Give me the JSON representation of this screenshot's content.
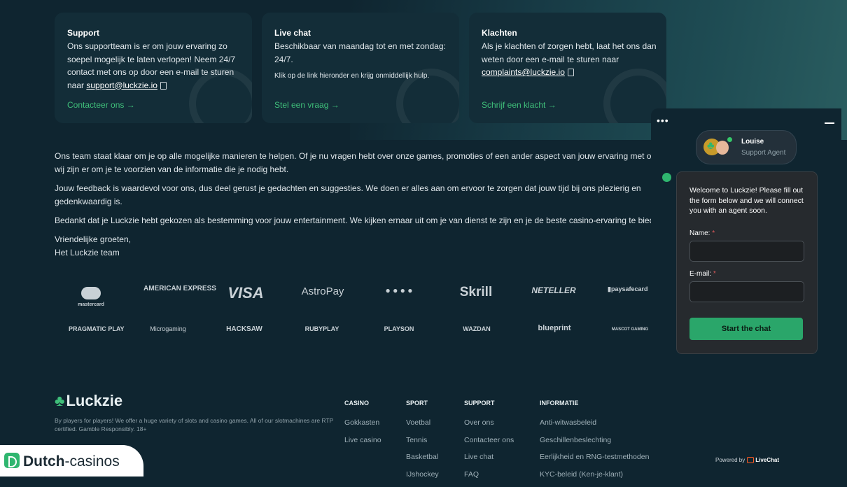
{
  "cards": [
    {
      "title": "Support",
      "body": "Ons supportteam is er om jouw ervaring zo soepel mogelijk te laten verlopen! Neem 24/7 contact met ons op door een e-mail te sturen naar ",
      "email": "support@luckzie.io",
      "link": "Contacteer ons →"
    },
    {
      "title": "Live chat",
      "body": "Beschikbaar van maandag tot en met zondag: 24/7.",
      "small": "Klik op de link hieronder en krijg onmiddellijk hulp.",
      "link": "Stel een vraag →"
    },
    {
      "title": "Klachten",
      "body": "Als je klachten of zorgen hebt, laat het ons dan weten door een e-mail te sturen naar ",
      "email": "complaints@luckzie.io",
      "link": "Schrijf een klacht →"
    }
  ],
  "paragraphs": [
    "Ons team staat klaar om je op alle mogelijke manieren te helpen. Of je nu vragen hebt over onze games, promoties of een ander aspect van jouw ervaring met o wij zijn er om je te voorzien van de informatie die je nodig hebt.",
    "Jouw feedback is waardevol voor ons, dus deel gerust je gedachten en suggesties. We doen er alles aan om ervoor te zorgen dat jouw tijd bij ons plezierig en gedenkwaardig is.",
    "Bedankt dat je Luckzie hebt gekozen als bestemming voor jouw entertainment. We kijken ernaar uit om je van dienst te zijn en je de beste casino-ervaring te bied",
    "Vriendelijke groeten,",
    "Het Luckzie team"
  ],
  "payment_logos": [
    "mastercard",
    "AMERICAN EXPRESS",
    "VISA",
    "AstroPay",
    "● ● ● ●",
    "Skrill",
    "NETELLER",
    "▮paysafecard"
  ],
  "provider_logos": [
    "PRAGMATIC PLAY",
    "Microgaming",
    "HACKSAW",
    "RUBYPLAY",
    "PLAYSON",
    "WAZDAN",
    "blueprint",
    "MASCOT GAMING"
  ],
  "footer": {
    "brand": "Luckzie",
    "tagline": "By players for players! We offer a huge variety of slots and casino games. All of our slotmachines are RTP certified. Gamble Responsibly. 18+",
    "columns": [
      {
        "title": "CASINO",
        "items": [
          "Gokkasten",
          "Live casino"
        ]
      },
      {
        "title": "SPORT",
        "items": [
          "Voetbal",
          "Tennis",
          "Basketbal",
          "IJshockey"
        ]
      },
      {
        "title": "SUPPORT",
        "items": [
          "Over ons",
          "Contacteer ons",
          "Live chat",
          "FAQ"
        ]
      },
      {
        "title": "INFORMATIE",
        "items": [
          "Anti-witwasbeleid",
          "Geschillenbeslechting",
          "Eerlijkheid en RNG-testmethoden",
          "KYC-beleid (Ken-je-klant)"
        ]
      }
    ]
  },
  "watermark": {
    "bold": "Dutch",
    "rest": "-casinos"
  },
  "chat": {
    "menu": "•••",
    "agent_name": "Louise",
    "agent_role": "Support Agent",
    "welcome": "Welcome to Luckzie! Please fill out the form below and we will connect you with an agent soon.",
    "name_label": "Name:",
    "email_label": "E-mail:",
    "required_mark": "*",
    "name_value": "",
    "email_value": "",
    "start_label": "Start the chat",
    "powered_by": "Powered by",
    "powered_brand": "LiveChat"
  },
  "colors": {
    "accent": "#3fbf7a",
    "background": "#0f2530",
    "chat_button": "#2aa66a"
  }
}
